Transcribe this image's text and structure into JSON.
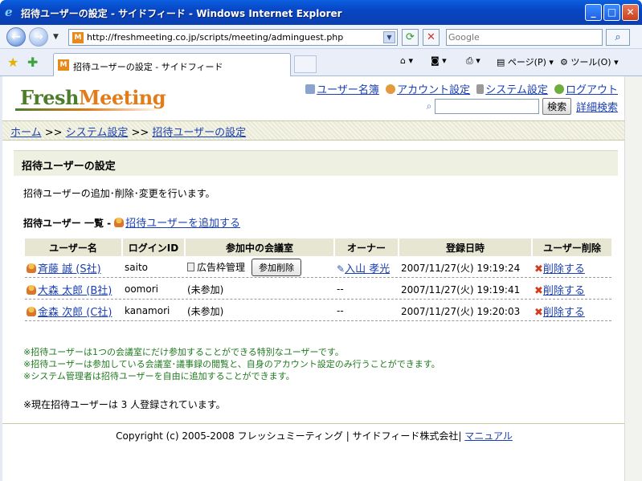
{
  "window": {
    "title": "招待ユーザーの設定 - サイドフィード - Windows Internet Explorer",
    "minimize": "_",
    "maximize": "□",
    "close": "✕"
  },
  "browser": {
    "url": "http://freshmeeting.co.jp/scripts/meeting/adminguest.php",
    "search_placeholder": "Google",
    "tab_title": "招待ユーザーの設定 - サイドフィード",
    "page_menu": "ページ(P)",
    "tools_menu": "ツール(O)"
  },
  "site": {
    "logo_part1": "Fresh",
    "logo_part2": "Meeting",
    "nav": {
      "user_list": "ユーザー名簿",
      "account_settings": "アカウント設定",
      "system_settings": "システム設定",
      "logout": "ログアウト"
    },
    "search_button": "検索",
    "advanced_search": "詳細検索"
  },
  "breadcrumb": {
    "home": "ホーム",
    "sep": ">>",
    "system": "システム設定",
    "current": "招待ユーザーの設定"
  },
  "section": {
    "title": "招待ユーザーの設定",
    "intro": "招待ユーザーの追加･削除･変更を行います。",
    "list_title": "招待ユーザー 一覧 -",
    "add_link": "招待ユーザーを追加する"
  },
  "table": {
    "headers": [
      "ユーザー名",
      "ログインID",
      "参加中の会議室",
      "オーナー",
      "登録日時",
      "ユーザー削除"
    ],
    "rows": [
      {
        "name": "斉藤 誠 (S社)",
        "login": "saito",
        "room": "広告枠管理",
        "leave": "参加削除",
        "owner": "入山 孝光",
        "date": "2007/11/27(火) 19:19:24",
        "delete": "削除する"
      },
      {
        "name": "大森 太郎 (B社)",
        "login": "oomori",
        "room": "(未参加)",
        "owner": "--",
        "date": "2007/11/27(火) 19:19:41",
        "delete": "削除する"
      },
      {
        "name": "金森 次郎 (C社)",
        "login": "kanamori",
        "room": "(未参加)",
        "owner": "--",
        "date": "2007/11/27(火) 19:20:03",
        "delete": "削除する"
      }
    ]
  },
  "notes": [
    "※招待ユーザーは1つの会議室にだけ参加することができる特別なユーザーです。",
    "※招待ユーザーは参加している会議室･議事録の閲覧と、自身のアカウント設定のみ行うことができます。",
    "※システム管理者は招待ユーザーを自由に追加することができます。"
  ],
  "count_text": "※現在招待ユーザーは 3 人登録されています。",
  "footer": {
    "copyright": "Copyright (c) 2005-2008 フレッシュミーティング | サイドフィード株式会社|",
    "manual": "マニュアル"
  },
  "colors": {
    "logo_green": "#4d7d2a",
    "logo_orange": "#e27b1a",
    "link": "#1a3fb3",
    "note_green": "#1f7a1f"
  }
}
